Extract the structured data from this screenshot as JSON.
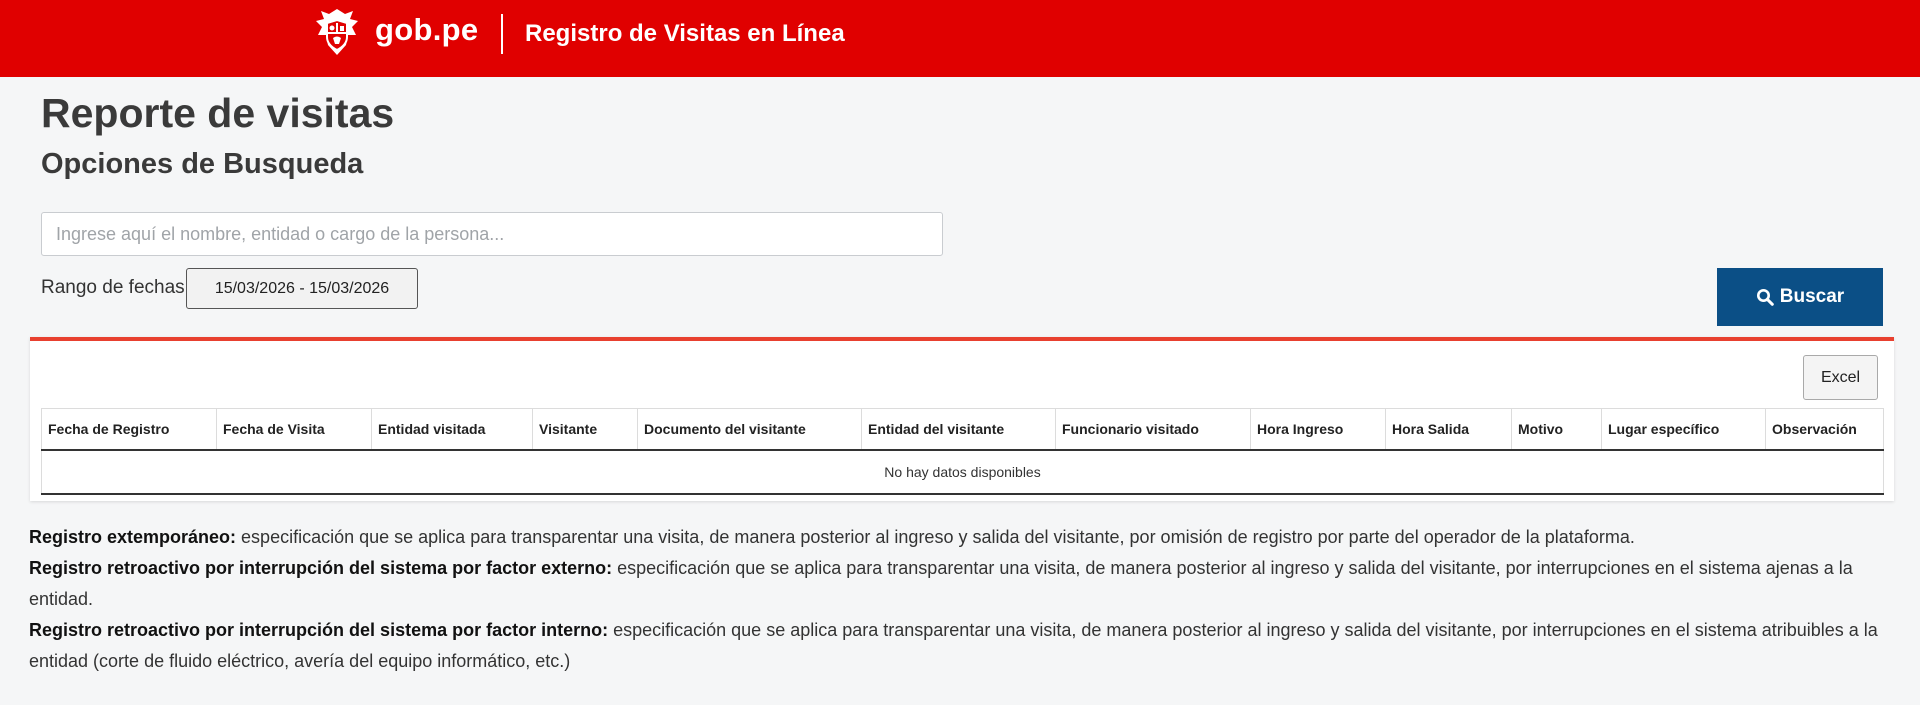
{
  "header": {
    "brand_icon": "peru-coat-of-arms-icon",
    "brand_text": "gob.pe",
    "title": "Registro de Visitas en Línea",
    "brand_color": "#e00000"
  },
  "page": {
    "title": "Reporte de visitas",
    "section_title": "Opciones de Busqueda"
  },
  "search": {
    "placeholder": "Ingrese aquí el nombre, entidad o cargo de la persona...",
    "value": "",
    "date_label": "Rango de fechas",
    "date_range": "15/03/2026 - 15/03/2026",
    "button_icon": "search-icon",
    "button_label": "Buscar",
    "button_color": "#0b4f86"
  },
  "results": {
    "export_label": "Excel",
    "columns": [
      "Fecha de Registro",
      "Fecha de Visita",
      "Entidad visitada",
      "Visitante",
      "Documento del visitante",
      "Entidad del visitante",
      "Funcionario visitado",
      "Hora Ingreso",
      "Hora Salida",
      "Motivo",
      "Lugar específico",
      "Observación"
    ],
    "empty_message": "No hay datos disponibles",
    "accent_color": "#e8402f"
  },
  "notes": [
    {
      "term": "Registro extemporáneo:",
      "text": " especificación que se aplica para transparentar una visita, de manera posterior al ingreso y salida del visitante, por omisión de registro por parte del operador de la plataforma."
    },
    {
      "term": "Registro retroactivo por interrupción del sistema por factor externo:",
      "text": " especificación que se aplica para transparentar una visita, de manera posterior al ingreso y salida del visitante, por interrupciones en el sistema ajenas a la entidad."
    },
    {
      "term": "Registro retroactivo por interrupción del sistema por factor interno:",
      "text": " especificación que se aplica para transparentar una visita, de manera posterior al ingreso y salida del visitante, por interrupciones en el sistema atribuibles a la entidad (corte de fluido eléctrico, avería del equipo informático, etc.)"
    }
  ]
}
